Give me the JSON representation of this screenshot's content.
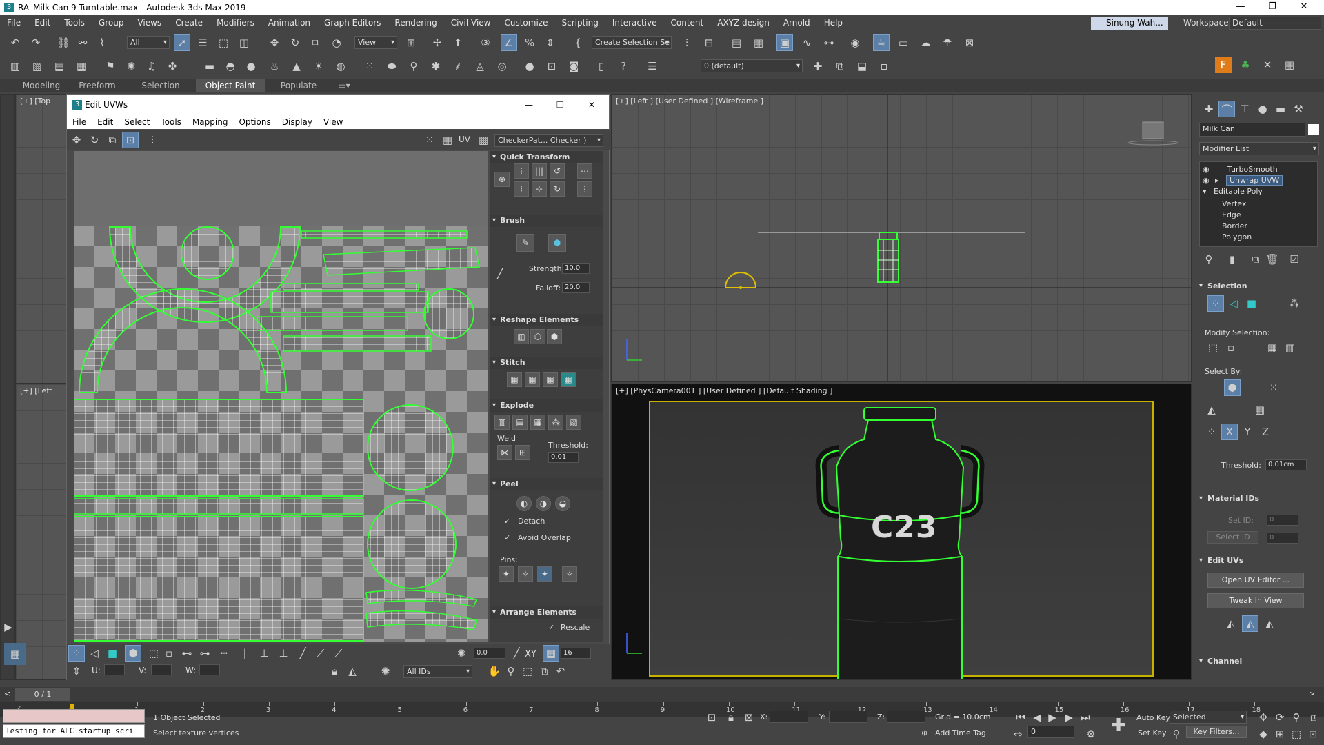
{
  "app": {
    "title": "RA_Milk Can 9 Turntable.max - Autodesk 3ds Max 2019",
    "win_min": "—",
    "win_max": "❐",
    "win_close": "✕"
  },
  "menu": [
    "File",
    "Edit",
    "Tools",
    "Group",
    "Views",
    "Create",
    "Modifiers",
    "Animation",
    "Graph Editors",
    "Rendering",
    "Civil View",
    "Customize",
    "Scripting",
    "Interactive",
    "Content",
    "AXYZ design",
    "Arnold",
    "Help"
  ],
  "user": {
    "name": "Sinung Wah..."
  },
  "workspace": {
    "label": "Workspaces:",
    "value": "Default"
  },
  "toolbar": {
    "selection_filter": "All",
    "ref_coord": "View",
    "named_selection": "Create Selection Se",
    "layer": "0 (default)"
  },
  "ribbon_tabs": [
    "Modeling",
    "Freeform",
    "Selection",
    "Object Paint",
    "Populate"
  ],
  "viewports": {
    "top_label": "[+] [Top",
    "left_label": "[+] [Left",
    "main_left_label": "[+] [Left ] [User Defined ] [Wireframe ]",
    "camera_label": "[+] [PhysCamera001 ] [User Defined ] [Default Shading ]",
    "can_text": "C23"
  },
  "uvw_editor": {
    "title": "Edit UVWs",
    "menu": [
      "File",
      "Edit",
      "Select",
      "Tools",
      "Mapping",
      "Options",
      "Display",
      "View"
    ],
    "uv_label": "UV",
    "texture": "CheckerPat... Checker )",
    "rollouts": {
      "quick_transform": "Quick Transform",
      "brush": "Brush",
      "strength_label": "Strength:",
      "strength": "10.0",
      "falloff_label": "Falloff:",
      "falloff": "20.0",
      "reshape": "Reshape Elements",
      "stitch": "Stitch",
      "explode": "Explode",
      "weld": "Weld",
      "threshold_label": "Threshold:",
      "threshold": "0.01",
      "peel": "Peel",
      "detach": "Detach",
      "avoid_overlap": "Avoid Overlap",
      "pins": "Pins:",
      "arrange": "Arrange Elements",
      "rescale": "Rescale"
    },
    "bottom": {
      "angle": "0.0",
      "xy": "XY",
      "count": "16",
      "u_label": "U:",
      "v_label": "V:",
      "w_label": "W:",
      "ids": "All IDs"
    }
  },
  "command_panel": {
    "object_name": "Milk Can",
    "modifier_list": "Modifier List",
    "stack": [
      "TurboSmooth",
      "Unwrap UVW",
      "Editable Poly",
      "Vertex",
      "Edge",
      "Border",
      "Polygon"
    ],
    "selection": "Selection",
    "modify_selection": "Modify Selection:",
    "select_by": "Select By:",
    "threshold_label": "Threshold:",
    "threshold": "0.01cm",
    "material_ids": "Material IDs",
    "set_id": "Set ID:",
    "select_id": "Select ID",
    "id_val": "0",
    "edit_uvs": "Edit UVs",
    "open_uv_editor": "Open UV Editor ...",
    "tweak_in_view": "Tweak In View",
    "channel": "Channel"
  },
  "timeline": {
    "frame_counter": "0 / 1",
    "ticks": [
      "0",
      "1",
      "2",
      "3",
      "4",
      "5",
      "6",
      "7",
      "8",
      "9",
      "10",
      "11",
      "12",
      "13",
      "14",
      "15",
      "16",
      "17",
      "18"
    ]
  },
  "status": {
    "script_line": "Testing for ALC startup scri",
    "selected": "1 Object Selected",
    "prompt": "Select texture vertices",
    "x_label": "X:",
    "y_label": "Y:",
    "z_label": "Z:",
    "grid": "Grid = 10.0cm",
    "add_time_tag": "Add Time Tag",
    "auto_key": "Auto Key",
    "set_key": "Set Key",
    "key_mode": "Selected",
    "key_filters": "Key Filters...",
    "frame": "0"
  },
  "colors": {
    "accent": "#5b7fa6",
    "wire": "#ffffff",
    "select_green": "#33ff33"
  }
}
